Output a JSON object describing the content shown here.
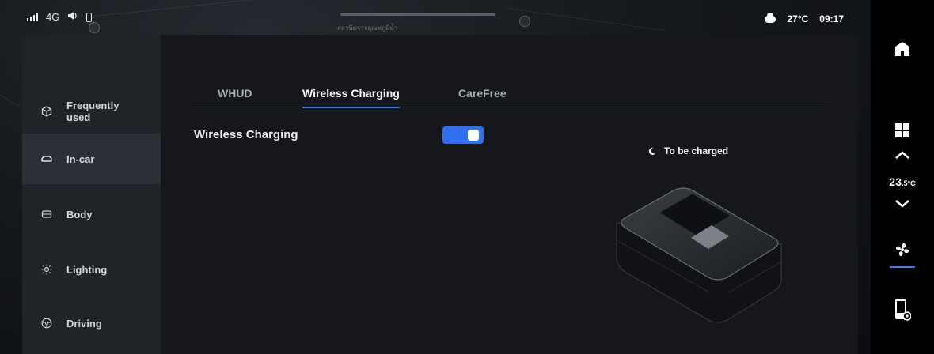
{
  "status_bar": {
    "network": "4G",
    "weather_icon": "cloud-icon",
    "temperature": "27°C",
    "time": "09:17"
  },
  "map": {
    "road_text": "สถานีตรวจอุณหภูมิน้ำ"
  },
  "sidebar": {
    "items": [
      {
        "label": "Frequently used",
        "icon": "cube-icon",
        "active": false
      },
      {
        "label": "In-car",
        "icon": "car-icon",
        "active": true
      },
      {
        "label": "Body",
        "icon": "body-icon",
        "active": false
      },
      {
        "label": "Lighting",
        "icon": "sun-icon",
        "active": false
      },
      {
        "label": "Driving",
        "icon": "steering-wheel-icon",
        "active": false
      }
    ]
  },
  "tabs": [
    {
      "label": "WHUD",
      "active": false
    },
    {
      "label": "Wireless Charging",
      "active": true
    },
    {
      "label": "CareFree",
      "active": false
    }
  ],
  "settings": {
    "wireless_charging_label": "Wireless Charging",
    "wireless_charging_enabled": true,
    "charge_status": "To be charged"
  },
  "dock": {
    "items": [
      "home-icon",
      "grid-icon",
      "chevron-up-icon",
      "chevron-down-icon",
      "fan-icon",
      "phone-settings-icon"
    ],
    "cabin_temp_value": "23",
    "cabin_temp_decimal": ".5°C"
  },
  "colors": {
    "accent": "#2f6ff0",
    "panel_bg": "#1a1c20",
    "sidebar_bg": "#202328",
    "sidebar_active": "#2b2f36"
  }
}
